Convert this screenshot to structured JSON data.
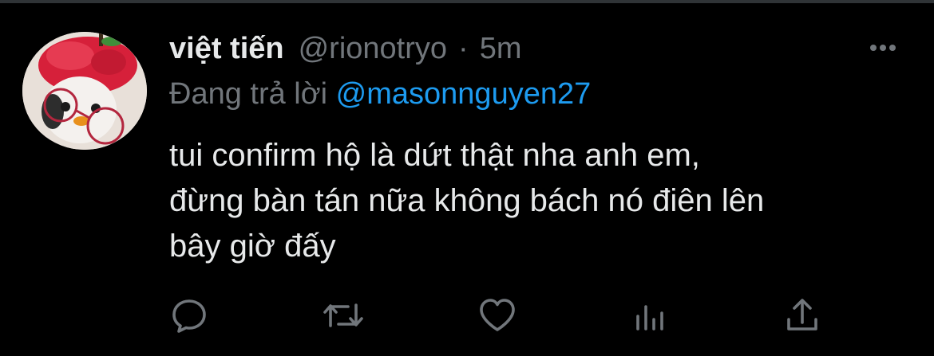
{
  "tweet": {
    "author_name": "việt tiến",
    "author_handle": "@rionotryo",
    "separator": "·",
    "time": "5m",
    "reply_label": "Đang trả lời",
    "reply_to": "@masonnguyen27",
    "text": "tui confirm hộ là dứt thật nha anh em,\nđừng bàn tán nữa không bách nó điên lên\nbây giờ đấy"
  },
  "actions": {
    "icons": [
      "reply-icon",
      "retweet-icon",
      "like-icon",
      "analytics-icon",
      "share-icon"
    ]
  },
  "colors": {
    "background": "#000000",
    "text_primary": "#e7e9ea",
    "text_secondary": "#71767b",
    "accent": "#1d9bf0",
    "icon": "#71767b"
  }
}
